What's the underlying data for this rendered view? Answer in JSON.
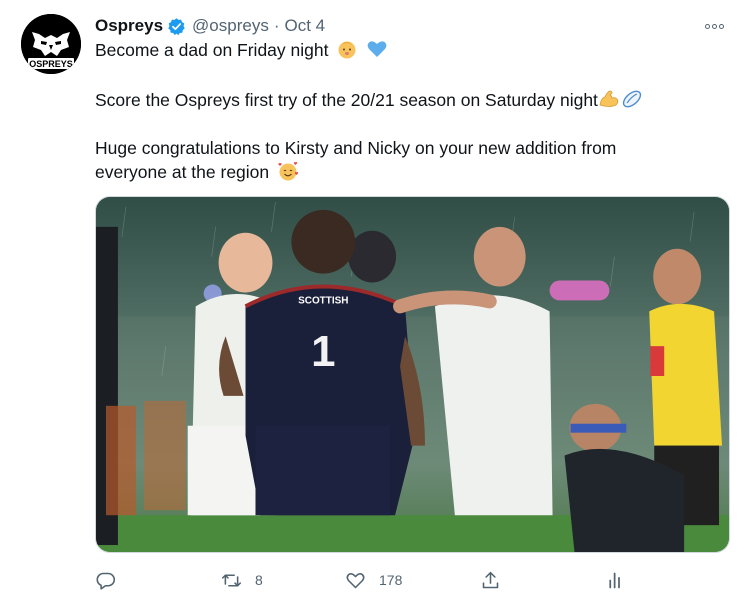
{
  "author": {
    "display_name": "Ospreys",
    "handle": "@ospreys",
    "separator": "·",
    "date": "Oct 4",
    "avatar_text": "OSPREYS",
    "verified_icon": "verified-badge-icon"
  },
  "tweet": {
    "lines": [
      "Become a dad on Friday night",
      "Score the Ospreys first try of the 20/21 season on Saturday night",
      "Huge congratulations to Kirsty and Nicky on your new addition from",
      "everyone at the region"
    ],
    "emojis": [
      "baby-icon",
      "blue-heart-icon",
      "flexed-biceps-icon",
      "rugby-ball-icon",
      "smiling-face-with-hearts-icon"
    ]
  },
  "media": {
    "type": "photo",
    "shirt_number": "1",
    "shirt_sponsor": "SCOTTISH"
  },
  "actions": {
    "reply": {
      "icon": "reply-icon",
      "count": ""
    },
    "retweet": {
      "icon": "retweet-icon",
      "count": "8"
    },
    "like": {
      "icon": "heart-icon",
      "count": "178"
    },
    "share": {
      "icon": "share-icon",
      "count": ""
    },
    "analytics": {
      "icon": "analytics-icon",
      "count": ""
    }
  },
  "colors": {
    "text": "#0f1419",
    "secondary": "#536471",
    "verified": "#1d9bf0",
    "divider": "#cfd9de"
  }
}
